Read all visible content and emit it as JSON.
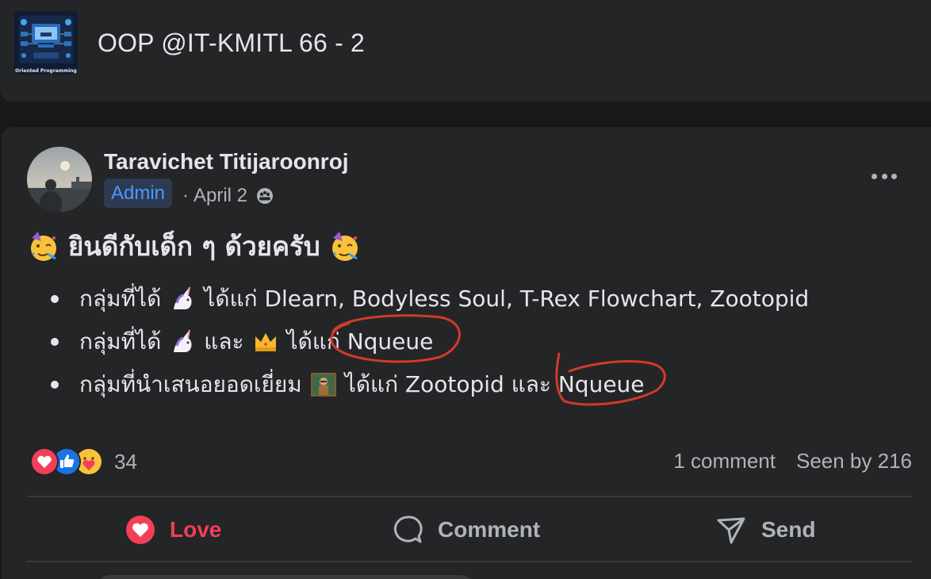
{
  "group": {
    "title": "OOP @IT-KMITL 66 - 2",
    "thumbnail_caption": "Oriented Programming"
  },
  "post": {
    "author": "Taravichet Titijaroonroj",
    "badge": "Admin",
    "date": "April 2",
    "meta_separator": "·",
    "privacy_icon": "group-members-icon",
    "headline": "ยินดีกับเด็ก ๆ ด้วยครับ",
    "headline_emoji": "partying-face",
    "bullets": [
      {
        "prefix": "กลุ่มที่ได้",
        "emoji1": "unicorn",
        "suffix": "ได้แก่ Dlearn, Bodyless Soul, T-Rex Flowchart, Zootopid"
      },
      {
        "prefix": "กลุ่มที่ได้",
        "emoji1": "unicorn",
        "joiner": "และ",
        "emoji2": "crown",
        "suffix": "ได้แก่ Nqueue"
      },
      {
        "prefix": "กลุ่มที่นำเสนอยอดเยี่ยม",
        "emoji1": "teacher",
        "suffix": "ได้แก่ Zootopid และ Nqueue"
      }
    ],
    "annotation_color": "#d23a2a"
  },
  "engagement": {
    "reaction_icons": [
      "love-reaction",
      "like-reaction",
      "care-reaction"
    ],
    "reaction_count": "34",
    "comments": "1 comment",
    "seen": "Seen by 216"
  },
  "actions": {
    "love": "Love",
    "comment": "Comment",
    "send": "Send"
  },
  "colors": {
    "background": "#181818",
    "card": "#242526",
    "text": "#e4e6eb",
    "muted": "#b0b3b8",
    "accent": "#4b9aff",
    "love": "#f33e58"
  }
}
